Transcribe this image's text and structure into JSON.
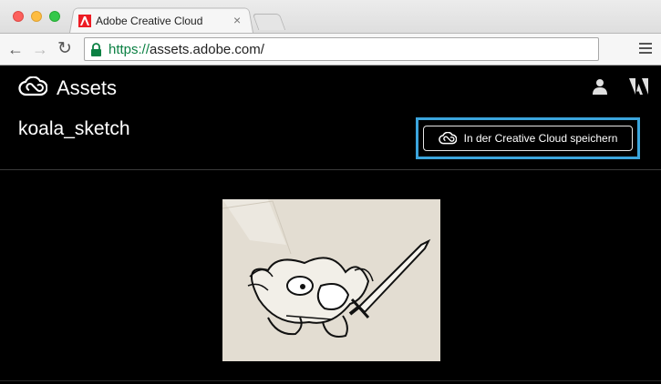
{
  "browser": {
    "tab_title": "Adobe Creative Cloud",
    "tab_close": "×",
    "url_scheme": "https://",
    "url_host": "assets.adobe.com/",
    "back": "←",
    "forward": "→",
    "reload": "↻"
  },
  "app": {
    "title": "Assets",
    "asset_name": "koala_sketch",
    "save_button_label": "In der Creative Cloud speichern"
  },
  "icons": {
    "logo": "creative-cloud-icon",
    "user": "user-icon",
    "adobe": "adobe-icon",
    "lock": "lock-icon",
    "menu": "menu-icon"
  },
  "colors": {
    "highlight": "#3ba5dd",
    "url_secure": "#0b8043",
    "background": "#000000"
  }
}
